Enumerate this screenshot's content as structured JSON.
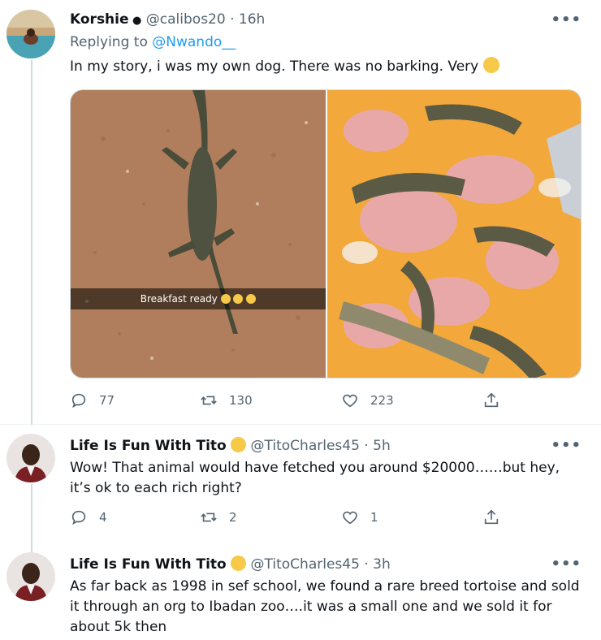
{
  "tweets": [
    {
      "name": "Korshie",
      "name_suffix": "",
      "handle": "@calibos20",
      "time": "16h",
      "replying_label": "Replying to",
      "replying_handle": "@Nwando__",
      "text": "In my story, i was my own dog. There was no barking. Very",
      "media_caption": "Breakfast ready",
      "replies": "77",
      "retweets": "130",
      "likes": "223"
    },
    {
      "name": "Life Is Fun With Tito",
      "handle": "@TitoCharles45",
      "time": "5h",
      "text": "Wow! That animal would have fetched you around $20000……but hey, it’s ok to each rich right?",
      "replies": "4",
      "retweets": "2",
      "likes": "1"
    },
    {
      "name": "Life Is Fun With Tito",
      "handle": "@TitoCharles45",
      "time": "3h",
      "text": "As far back as 1998 in sef school, we found a rare breed tortoise and sold it through an org to Ibadan zoo….it was a small one and we sold it for about 5k then"
    }
  ],
  "separator": "·",
  "more_label": "•••",
  "colors": {
    "link": "#1d9bf0",
    "muted": "#536471",
    "thread_line": "#cfd9de"
  }
}
